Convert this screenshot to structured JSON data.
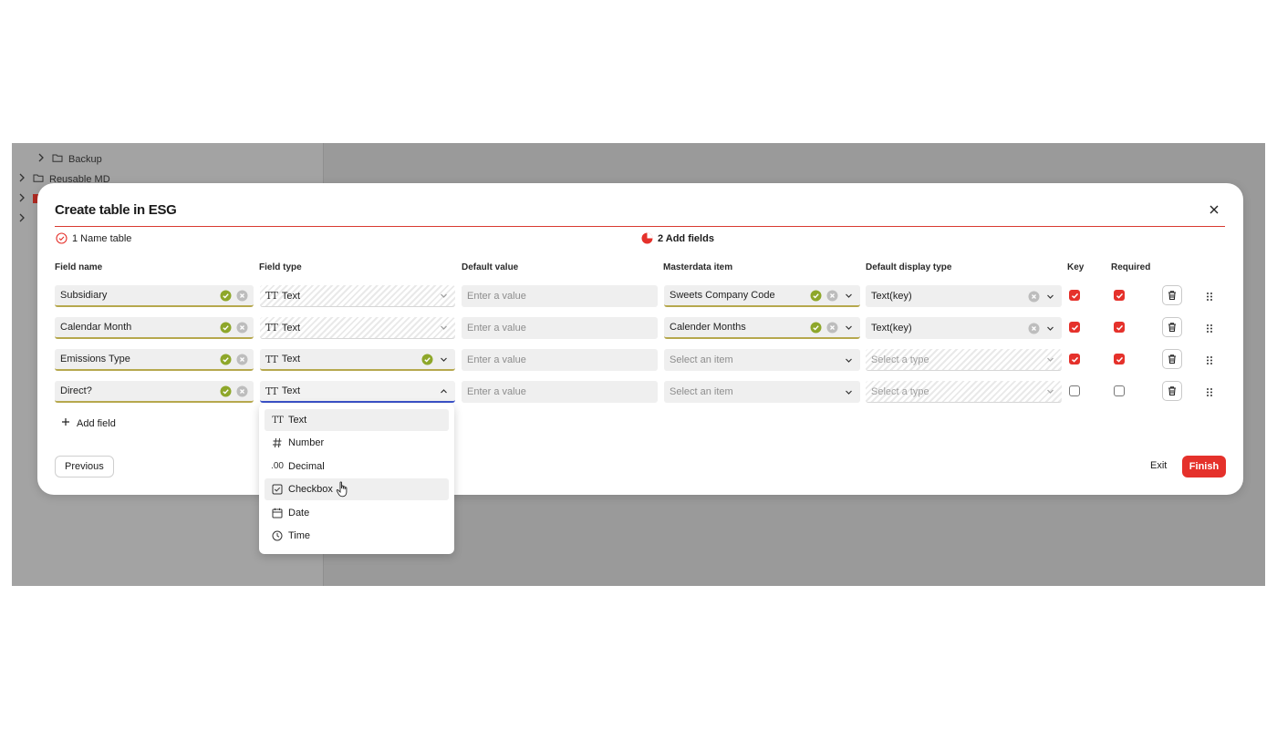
{
  "sidebar": {
    "items": [
      {
        "label": "Backup"
      },
      {
        "label": "Reusable MD"
      }
    ]
  },
  "modal": {
    "title": "Create table in ESG",
    "steps": [
      {
        "label": "1 Name table"
      },
      {
        "label": "2 Add fields"
      }
    ],
    "columns": {
      "field_name": "Field name",
      "field_type": "Field type",
      "default_value": "Default value",
      "masterdata_item": "Masterdata item",
      "default_display_type": "Default display type",
      "key": "Key",
      "required": "Required"
    },
    "rows": [
      {
        "field_name": "Subsidiary",
        "field_type": "Text",
        "default_value_placeholder": "Enter a value",
        "masterdata": "Sweets Company Code",
        "display_type": "Text(key)",
        "key": true,
        "required": true
      },
      {
        "field_name": "Calendar Month",
        "field_type": "Text",
        "default_value_placeholder": "Enter a value",
        "masterdata": "Calender Months",
        "display_type": "Text(key)",
        "key": true,
        "required": true
      },
      {
        "field_name": "Emissions Type",
        "field_type": "Text",
        "default_value_placeholder": "Enter a value",
        "masterdata_placeholder": "Select an item",
        "display_type_placeholder": "Select a type",
        "key": true,
        "required": true
      },
      {
        "field_name": "Direct?",
        "field_type": "Text",
        "default_value_placeholder": "Enter a value",
        "masterdata_placeholder": "Select an item",
        "display_type_placeholder": "Select a type",
        "key": false,
        "required": false
      }
    ],
    "add_field_label": "Add field",
    "previous_label": "Previous",
    "exit_label": "Exit",
    "finish_label": "Finish"
  },
  "field_type_dropdown": {
    "options": [
      {
        "label": "Text",
        "icon": "text-type-icon"
      },
      {
        "label": "Number",
        "icon": "hash-icon"
      },
      {
        "label": "Decimal",
        "icon": "decimal-icon",
        "glyph": ".00"
      },
      {
        "label": "Checkbox",
        "icon": "checkbox-icon"
      },
      {
        "label": "Date",
        "icon": "calendar-icon"
      },
      {
        "label": "Time",
        "icon": "clock-icon"
      }
    ],
    "selected": "Text",
    "hovered": "Checkbox"
  },
  "colors": {
    "accent_red": "#e5312b",
    "valid_green": "#8ea72a",
    "focus_blue": "#3b52c9"
  },
  "text_type_glyph": "TT"
}
